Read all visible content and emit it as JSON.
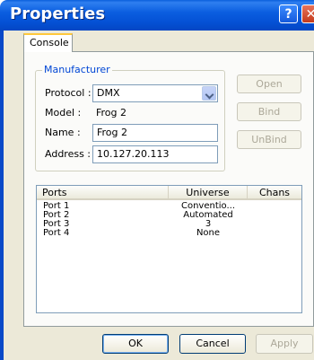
{
  "window": {
    "title": "Properties",
    "help_label": "?",
    "close_label": "✕"
  },
  "tabs": [
    {
      "label": "Console"
    }
  ],
  "manufacturer": {
    "group_label": "Manufacturer",
    "protocol_label": "Protocol :",
    "protocol_value": "DMX",
    "model_label": "Model :",
    "model_value": "Frog 2",
    "name_label": "Name :",
    "name_value": "Frog 2",
    "address_label": "Address :",
    "address_value": "10.127.20.113"
  },
  "side_buttons": {
    "open": "Open",
    "bind": "Bind",
    "unbind": "UnBind"
  },
  "ports_table": {
    "columns": [
      "Ports",
      "Universe",
      "Chans"
    ],
    "rows": [
      {
        "port": "Port 1",
        "universe": "Conventio...",
        "chans": ""
      },
      {
        "port": "Port 2",
        "universe": "Automated",
        "chans": ""
      },
      {
        "port": "Port 3",
        "universe": "3",
        "chans": ""
      },
      {
        "port": "Port 4",
        "universe": "None",
        "chans": ""
      }
    ]
  },
  "buttons": {
    "ok": "OK",
    "cancel": "Cancel",
    "apply": "Apply"
  }
}
